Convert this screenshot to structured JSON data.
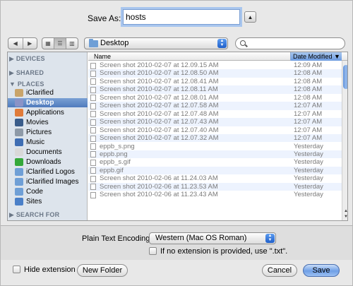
{
  "save": {
    "label": "Save As:",
    "filename": "hosts",
    "expand_icon": "triangle-up-icon"
  },
  "toolbar": {
    "back_icon": "◀",
    "forward_icon": "▶",
    "view_icons": [
      "▦",
      "☰",
      "▥"
    ],
    "location": "Desktop"
  },
  "sidebar": {
    "sections": {
      "devices": "DEVICES",
      "shared": "SHARED",
      "places": "PLACES",
      "search_for": "SEARCH FOR"
    },
    "items": [
      {
        "label": "iClarified",
        "icon": "home-icon",
        "color": "#c9a46a"
      },
      {
        "label": "Desktop",
        "icon": "desktop-icon",
        "color": "#8a93c7",
        "selected": true
      },
      {
        "label": "Applications",
        "icon": "applications-icon",
        "color": "#e07b3a"
      },
      {
        "label": "Movies",
        "icon": "movies-icon",
        "color": "#3a5c8a"
      },
      {
        "label": "Pictures",
        "icon": "pictures-icon",
        "color": "#8e9aa8"
      },
      {
        "label": "Music",
        "icon": "music-icon",
        "color": "#3e6db3"
      },
      {
        "label": "Documents",
        "icon": "documents-icon",
        "color": "#d8d8d8"
      },
      {
        "label": "Downloads",
        "icon": "downloads-icon",
        "color": "#34a83a"
      },
      {
        "label": "iClarified Logos",
        "icon": "folder-icon",
        "color": "#6f9fd6"
      },
      {
        "label": "iClarified Images",
        "icon": "folder-icon",
        "color": "#6f9fd6"
      },
      {
        "label": "Code",
        "icon": "folder-icon",
        "color": "#6f9fd6"
      },
      {
        "label": "Sites",
        "icon": "sites-icon",
        "color": "#4a7fc8"
      }
    ]
  },
  "files": {
    "columns": {
      "name": "Name",
      "date": "Date Modified"
    },
    "rows": [
      {
        "name": "Screen shot 2010-02-07 at 12.09.15 AM",
        "date": "12:09 AM"
      },
      {
        "name": "Screen shot 2010-02-07 at 12.08.50 AM",
        "date": "12:08 AM"
      },
      {
        "name": "Screen shot 2010-02-07 at 12.08.41 AM",
        "date": "12:08 AM"
      },
      {
        "name": "Screen shot 2010-02-07 at 12.08.11 AM",
        "date": "12:08 AM"
      },
      {
        "name": "Screen shot 2010-02-07 at 12.08.01 AM",
        "date": "12:08 AM"
      },
      {
        "name": "Screen shot 2010-02-07 at 12.07.58 AM",
        "date": "12:07 AM"
      },
      {
        "name": "Screen shot 2010-02-07 at 12.07.48 AM",
        "date": "12:07 AM"
      },
      {
        "name": "Screen shot 2010-02-07 at 12.07.43 AM",
        "date": "12:07 AM"
      },
      {
        "name": "Screen shot 2010-02-07 at 12.07.40 AM",
        "date": "12:07 AM"
      },
      {
        "name": "Screen shot 2010-02-07 at 12.07.32 AM",
        "date": "12:07 AM"
      },
      {
        "name": "eppb_s.png",
        "date": "Yesterday"
      },
      {
        "name": "eppb.png",
        "date": "Yesterday"
      },
      {
        "name": "eppb_s.gif",
        "date": "Yesterday"
      },
      {
        "name": "eppb.gif",
        "date": "Yesterday"
      },
      {
        "name": "Screen shot 2010-02-06 at 11.24.03 AM",
        "date": "Yesterday"
      },
      {
        "name": "Screen shot 2010-02-06 at 11.23.53 AM",
        "date": "Yesterday"
      },
      {
        "name": "Screen shot 2010-02-06 at 11.23.43 AM",
        "date": "Yesterday"
      }
    ]
  },
  "options": {
    "encoding_label": "Plain Text Encoding:",
    "encoding_value": "Western (Mac OS Roman)",
    "extension_note": "If no extension is provided, use \".txt\"."
  },
  "footer": {
    "hide_extension": "Hide extension",
    "new_folder": "New Folder",
    "cancel": "Cancel",
    "save": "Save"
  },
  "colors": {
    "accent": "#4f7bbd",
    "sidebar_bg": "#dde4ec",
    "row_alt": "#edf3fe",
    "focus_ring": "#a9c6ee"
  }
}
